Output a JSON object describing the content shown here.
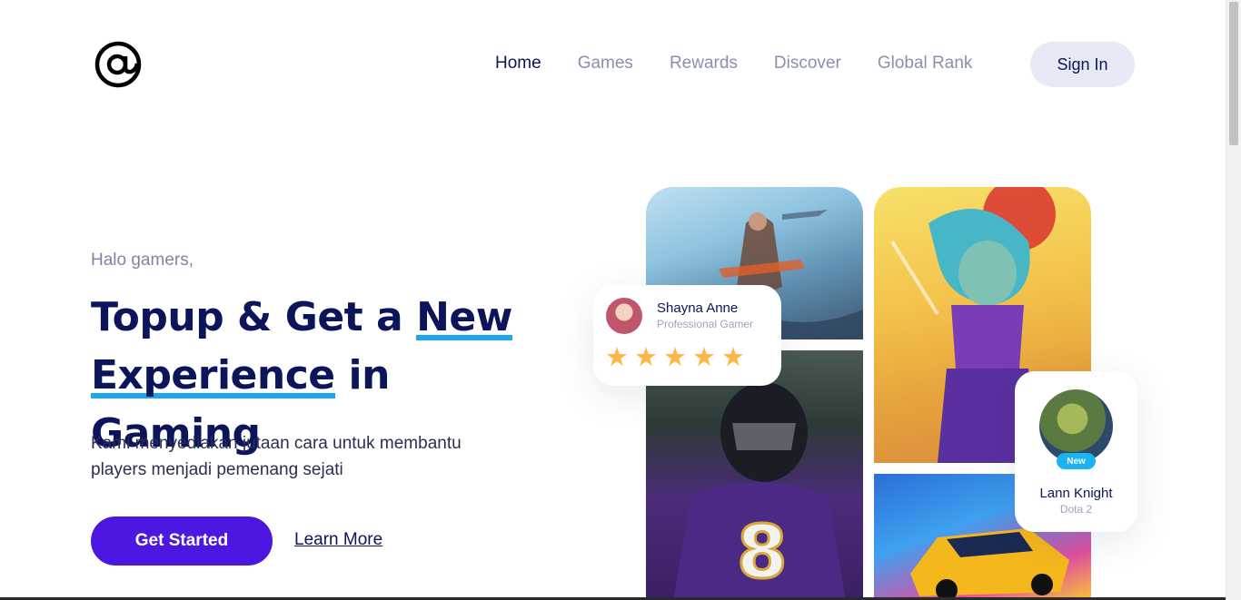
{
  "header": {
    "logo_glyph": "@",
    "nav": [
      {
        "label": "Home",
        "active": true
      },
      {
        "label": "Games",
        "active": false
      },
      {
        "label": "Rewards",
        "active": false
      },
      {
        "label": "Discover",
        "active": false
      },
      {
        "label": "Global Rank",
        "active": false
      }
    ],
    "signin_label": "Sign In"
  },
  "hero": {
    "greeting": "Halo gamers,",
    "headline_part1": "Topup & Get a",
    "headline_highlight1": "New",
    "headline_highlight2": "Experience",
    "headline_part2": "in Gaming",
    "description": "Kami menyediakan jutaan cara untuk membantu players menjadi pemenang sejati",
    "primary_button": "Get Started",
    "secondary_link": "Learn More"
  },
  "review_card": {
    "name": "Shayna Anne",
    "role": "Professional Gamer",
    "rating": 5,
    "star_glyph": "★"
  },
  "player_card": {
    "badge": "New",
    "name": "Lann Knight",
    "game": "Dota 2"
  },
  "colors": {
    "navy": "#0c145a",
    "primary": "#4d17e2",
    "highlight": "#1ba6ef",
    "star": "#ffb547",
    "badge": "#1cb3f4",
    "muted": "#8a8fae"
  }
}
